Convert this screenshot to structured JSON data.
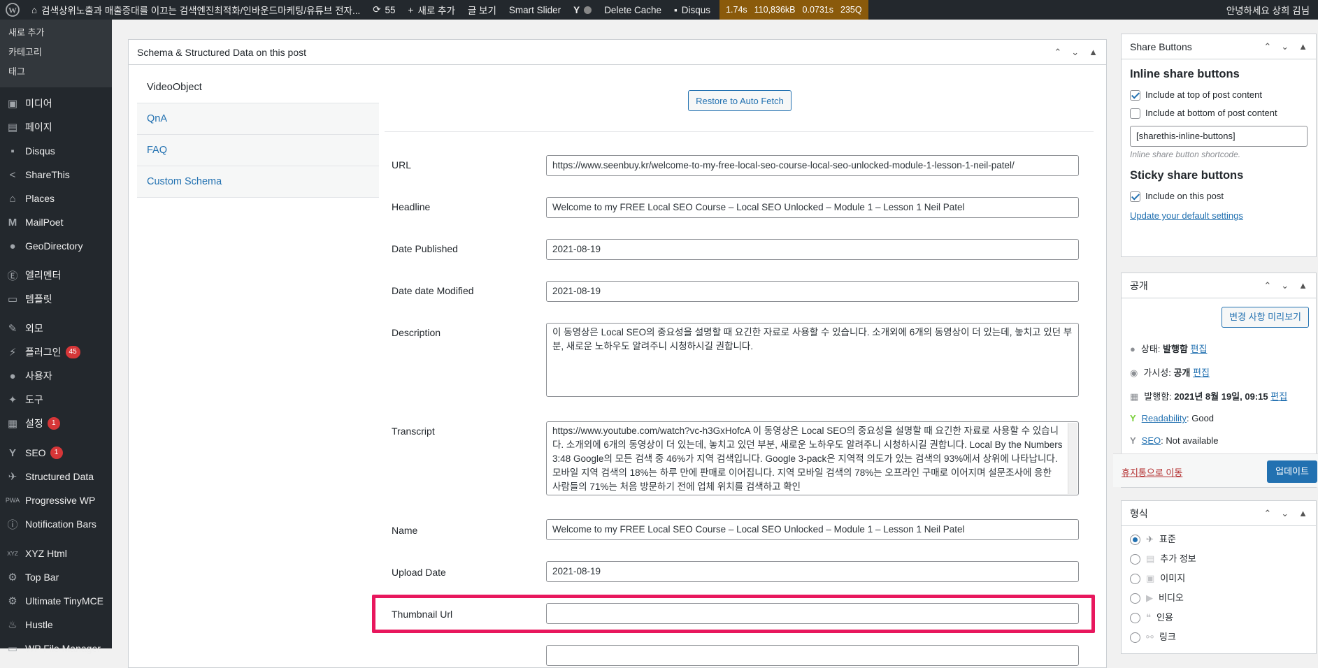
{
  "admin_bar": {
    "site_title": "검색상위노출과 매출증대를 이끄는 검색엔진최적화/인바운드마케팅/유튜브 전자...",
    "updates_count": "55",
    "new_label": "새로 추가",
    "view_post": "글 보기",
    "smart_slider": "Smart Slider",
    "delete_cache": "Delete Cache",
    "disqus": "Disqus",
    "qm_time": "1.74s",
    "qm_memory": "110,836kB",
    "qm_db_time": "0.0731s",
    "qm_queries": "235Q",
    "greeting": "안녕하세요 상희 김님"
  },
  "sidebar": {
    "submenu": [
      "새로 추가",
      "카테고리",
      "태그"
    ],
    "items": [
      {
        "label": "미디어",
        "icon": "media-icon"
      },
      {
        "label": "페이지",
        "icon": "page-icon"
      },
      {
        "label": "Disqus",
        "icon": "comment-icon"
      },
      {
        "label": "ShareThis",
        "icon": "share-icon"
      },
      {
        "label": "Places",
        "icon": "places-icon"
      },
      {
        "label": "MailPoet",
        "icon": "mailpoet-icon"
      },
      {
        "label": "GeoDirectory",
        "icon": "globe-icon"
      },
      {
        "label": "엘리멘터",
        "icon": "elementor-icon"
      },
      {
        "label": "템플릿",
        "icon": "folder-icon"
      },
      {
        "label": "외모",
        "icon": "brush-icon"
      },
      {
        "label": "플러그인",
        "icon": "plugin-icon",
        "badge": "45"
      },
      {
        "label": "사용자",
        "icon": "user-icon"
      },
      {
        "label": "도구",
        "icon": "wrench-icon"
      },
      {
        "label": "설정",
        "icon": "settings-icon",
        "badge": "1"
      },
      {
        "label": "SEO",
        "icon": "yoast-icon",
        "badge": "1"
      },
      {
        "label": "Structured Data",
        "icon": "pin-icon"
      },
      {
        "label": "Progressive WP",
        "icon": "pwa-icon"
      },
      {
        "label": "Notification Bars",
        "icon": "info-icon"
      },
      {
        "label": "XYZ Html",
        "icon": "xyz-icon"
      },
      {
        "label": "Top Bar",
        "icon": "gear-icon"
      },
      {
        "label": "Ultimate TinyMCE",
        "icon": "gear-icon"
      },
      {
        "label": "Hustle",
        "icon": "hustle-icon"
      },
      {
        "label": "WP File Manager",
        "icon": "folder-icon"
      }
    ]
  },
  "schema": {
    "title": "Schema & Structured Data on this post",
    "tabs": [
      "VideoObject",
      "QnA",
      "FAQ",
      "Custom Schema"
    ],
    "restore_button": "Restore to Auto Fetch",
    "fields": {
      "url_label": "URL",
      "url_value": "https://www.seenbuy.kr/welcome-to-my-free-local-seo-course-local-seo-unlocked-module-1-lesson-1-neil-patel/",
      "headline_label": "Headline",
      "headline_value": "Welcome to my FREE Local SEO Course – Local SEO Unlocked – Module 1 – Lesson 1 Neil Patel",
      "date_published_label": "Date Published",
      "date_published_value": "2021-08-19",
      "date_modified_label": "Date date Modified",
      "date_modified_value": "2021-08-19",
      "description_label": "Description",
      "description_value": "이 동영상은 Local SEO의 중요성을 설명할 때 요긴한 자료로 사용할 수 있습니다.     소개외에 6개의 동영상이 더 있는데, 놓치고 있던 부분, 새로운 노하우도 알려주니 시청하시길 권합니다.",
      "transcript_label": "Transcript",
      "transcript_value": "https://www.youtube.com/watch?vc-h3GxHofcA     이 동영상은 Local SEO의 중요성을 설명할 때 요긴한 자료로 사용할 수 있습니다.     소개외에 6개의 동영상이 더 있는데, 놓치고 있던 부분, 새로운 노하우도 알려주니 시청하시길 권합니다.        Local By the Numbers  3:48    Google의 모든 검색 중 46%가 지역 검색입니다. Google 3-pack은 지역적 의도가 있는 검색의 93%에서 상위에 나타납니다. 모바일 지역 검색의 18%는 하루 만에 판매로 이어집니다. 지역 모바일 검색의 78%는 오프라인 구매로 이어지며 설문조사에 응한 사람들의 71%는 처음 방문하기 전에 업체 위치를 검색하고 확인",
      "name_label": "Name",
      "name_value": "Welcome to my FREE Local SEO Course – Local SEO Unlocked – Module 1 – Lesson 1 Neil Patel",
      "upload_date_label": "Upload Date",
      "upload_date_value": "2021-08-19",
      "thumbnail_label": "Thumbnail Url",
      "thumbnail_value": ""
    }
  },
  "share_box": {
    "title": "Share Buttons",
    "inline_heading": "Inline share buttons",
    "include_top": "Include at top of post content",
    "include_bottom": "Include at bottom of post content",
    "shortcode": "[sharethis-inline-buttons]",
    "shortcode_hint": "Inline share button shortcode.",
    "sticky_heading": "Sticky share buttons",
    "include_post": "Include on this post",
    "update_link": "Update your default settings"
  },
  "publish_box": {
    "title": "공개",
    "preview_button": "변경 사항 미리보기",
    "status_label": "상태:",
    "status_value": "발행함",
    "edit": "편집",
    "visibility_label": "가시성:",
    "visibility_value": "공개",
    "published_label": "발행함:",
    "published_value": "2021년 8월 19일, 09:15",
    "readability_link": "Readability",
    "readability_value": ": Good",
    "seo_link": "SEO",
    "seo_value": ": Not available",
    "trash_link": "휴지통으로 이동",
    "update_button": "업데이트"
  },
  "format_box": {
    "title": "형식",
    "options": [
      "표준",
      "추가 정보",
      "이미지",
      "비디오",
      "인용",
      "링크"
    ]
  },
  "colors": {
    "accent": "#2271b1",
    "highlight": "#e8175d",
    "admin_bar": "#23282d"
  }
}
